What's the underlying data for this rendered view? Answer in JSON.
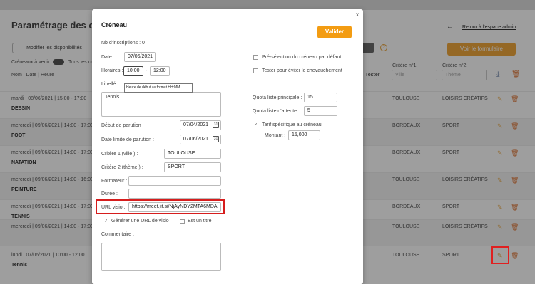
{
  "page": {
    "title": "Paramétrage des créneaux",
    "back_link": "Retour à l'espace admin",
    "btn_dispo": "Modifier les disponibilités",
    "btn_form": "Voir le formulaire",
    "help_glyph": "?",
    "toggle_label": "Créneaux à venir",
    "toggle_label2": "Tous les créneaux",
    "columns": {
      "nom": "Nom | Date | Heure",
      "tester": "Tester",
      "crit1": "Critère n°1",
      "crit2": "Critère n°2"
    },
    "filters": {
      "ville_placeholder": "Ville",
      "theme_placeholder": "Thème"
    },
    "rows": [
      {
        "date": "mardi | 08/06/2021 | 15:00 - 17:00",
        "activity": "DESSIN",
        "ville": "TOULOUSE",
        "theme": "LOISIRS CRÉATIFS"
      },
      {
        "date": "mercredi | 09/06/2021 | 14:00 - 17:00",
        "activity": "FOOT",
        "ville": "BORDEAUX",
        "theme": "SPORT"
      },
      {
        "date": "mercredi | 09/06/2021 | 14:00 - 17:00",
        "activity": "NATATION",
        "ville": "BORDEAUX",
        "theme": "SPORT"
      },
      {
        "date": "mercredi | 09/06/2021 | 14:00 - 16:00",
        "activity": "PEINTURE",
        "ville": "TOULOUSE",
        "theme": "LOISIRS CRÉATIFS"
      },
      {
        "date": "mercredi | 09/06/2021 | 14:00 - 17:00",
        "activity": "TENNIS",
        "ville": "BORDEAUX",
        "theme": "SPORT"
      },
      {
        "date": "mercredi | 09/06/2021 | 14:00 - 17:00",
        "activity": "",
        "ville": "TOULOUSE",
        "theme": "LOISIRS CRÉATIFS"
      },
      {
        "date": "lundi | 07/06/2021 | 10:00 - 12:00",
        "activity": "Tennis",
        "ville": "TOULOUSE",
        "theme": "SPORT"
      }
    ]
  },
  "modal": {
    "title": "Créneau",
    "close": "x",
    "valider": "Valider",
    "nb_inscriptions": "Nb d'inscriptions : 0",
    "date_label": "Date :",
    "date_value": "07/06/2021",
    "horaires_label": "Horaires :",
    "heure_debut": "10:00",
    "separator": "-",
    "heure_fin": "12:00",
    "libelle_label": "Libellé :",
    "libelle_value": "Tennis",
    "tooltip": "Heure de début au format HH:MM",
    "debut_parution_label": "Début de parution :",
    "debut_parution_value": "07/04/2021",
    "limite_parution_label": "Date limite de parution :",
    "limite_parution_value": "07/06/2021",
    "critere1_label": "Critère 1 (ville ) :",
    "critere1_value": "TOULOUSE",
    "critere2_label": "Critère 2 (thème ) :",
    "critere2_value": "SPORT",
    "formateur_label": "Formateur :",
    "formateur_value": "",
    "duree_label": "Durée :",
    "duree_value": "",
    "url_label": "URL visio :",
    "url_value": "https://meet.jit.si/NjAyNDY2MTA6MDA",
    "generer_url_label": "Générer une URL de visio",
    "est_titre_label": "Est un titre",
    "commentaire_label": "Commentaire :",
    "commentaire_value": "",
    "preselection_label": "Pré-sélection du créneau par défaut",
    "tester_label": "Tester pour éviter le chevauchement",
    "quota_principale_label": "Quota liste principale :",
    "quota_principale_value": "15",
    "quota_attente_label": "Quota liste d'attente :",
    "quota_attente_value": "5",
    "tarif_label": "Tarif spécifique au créneau",
    "montant_label": "Montant :",
    "montant_value": "15,000"
  },
  "icons": {
    "back_arrow": "←",
    "download": "⤓",
    "trash": "🗑",
    "pencil": "✎",
    "calendar": "31",
    "check": "✓"
  },
  "colors": {
    "accent": "#f39c12",
    "highlight": "#d61d1d",
    "link_blue": "#3a5a8c"
  }
}
